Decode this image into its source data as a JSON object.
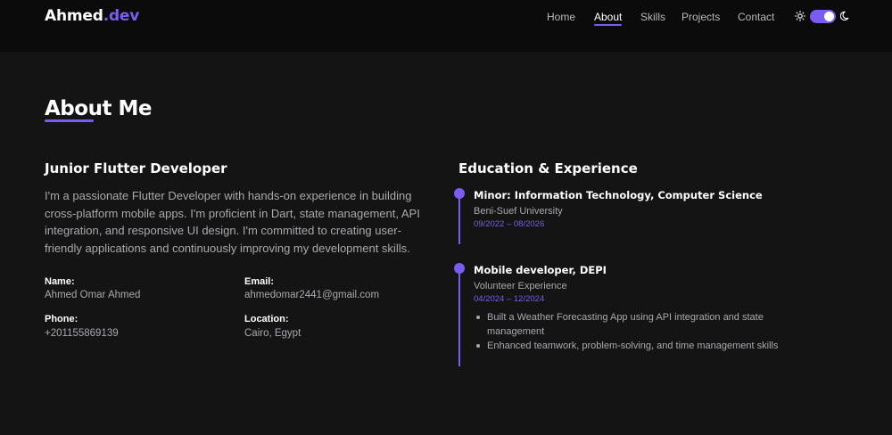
{
  "header": {
    "logo_main": "Ahmed",
    "logo_accent": ".dev",
    "nav": [
      "Home",
      "About",
      "Skills",
      "Projects",
      "Contact"
    ],
    "active_nav": "About",
    "theme_toggle_on": true,
    "icons": [
      "sun-icon",
      "moon-icon"
    ]
  },
  "about": {
    "title": "About Me",
    "role": "Junior Flutter Developer",
    "bio": "I'm a passionate Flutter Developer with hands-on experience in building cross-platform mobile apps. I'm proficient in Dart, state management, API integration, and responsive UI design. I'm committed to creating user-friendly applications and continuously improving my development skills.",
    "info": {
      "name_label": "Name:",
      "name_value": "Ahmed Omar Ahmed",
      "email_label": "Email:",
      "email_value": "ahmedomar2441@gmail.com",
      "phone_label": "Phone:",
      "phone_value": "+201155869139",
      "location_label": "Location:",
      "location_value": "Cairo, Egypt"
    }
  },
  "education": {
    "title": "Education & Experience",
    "entries": [
      {
        "title": "Minor: Information Technology, Computer Science",
        "org": "Beni-Suef University",
        "date": "09/2022 – 08/2026"
      },
      {
        "title": "Mobile developer, DEPI",
        "org": "Volunteer Experience",
        "date": "04/2024 – 12/2024",
        "bullets": [
          "Built a Weather Forecasting App using API integration and state management",
          "Enhanced teamwork, problem-solving, and time management skills"
        ]
      }
    ]
  },
  "colors": {
    "accent": "#7b5cf0",
    "background": "#141415",
    "header_background": "#0b0b0c"
  }
}
